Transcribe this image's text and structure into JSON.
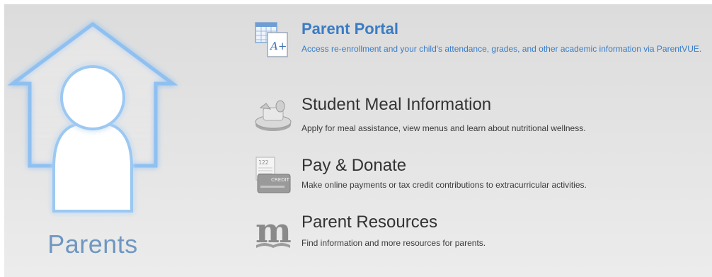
{
  "hero": {
    "label": "Parents",
    "icon": "house-person-icon"
  },
  "items": [
    {
      "title": "Parent Portal",
      "description": "Access re-enrollment and your child's attendance, grades, and other academic information via ParentVUE.",
      "icon": "calendar-grade-icon"
    },
    {
      "title": "Student Meal Information",
      "description": "Apply for meal assistance, view menus and learn about nutritional wellness.",
      "icon": "meal-tray-icon"
    },
    {
      "title": "Pay & Donate",
      "description": "Make online payments or tax credit contributions to extracurricular activities.",
      "icon": "credit-card-icon",
      "icon_text": "CREDIT",
      "icon_number": "122"
    },
    {
      "title": "Parent Resources",
      "description": "Find information and more resources for parents.",
      "icon": "book-m-icon",
      "icon_letter": "m"
    }
  ],
  "colors": {
    "accent": "#3a7cc4",
    "hero_label": "#6f97c0",
    "house_glow": "#7fb2e8",
    "text_dark": "#333333"
  }
}
